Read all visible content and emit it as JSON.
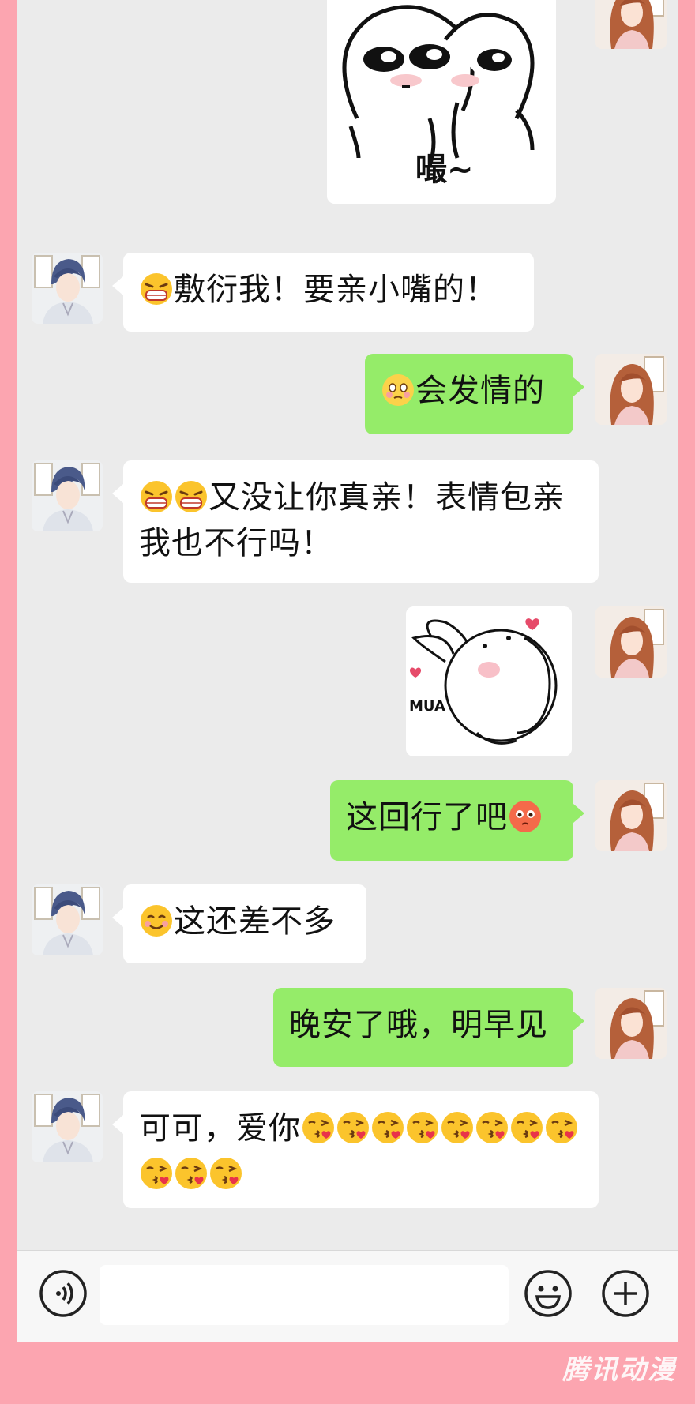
{
  "chat": {
    "messages": [
      {
        "side": "left",
        "emoji": [
          "grimace"
        ],
        "text": "敷衍我！要亲小嘴的！"
      },
      {
        "side": "right",
        "emoji": [
          "flushed"
        ],
        "text": "会发情的"
      },
      {
        "side": "left",
        "emoji": [
          "grimace",
          "grimace"
        ],
        "text": "又没让你真亲！表情包亲我也不行吗！"
      },
      {
        "side": "right",
        "sticker": true,
        "sticker_text": "MUA"
      },
      {
        "side": "right",
        "text": "这回行了吧",
        "emoji_after": [
          "flushed-red"
        ]
      },
      {
        "side": "left",
        "emoji": [
          "smile"
        ],
        "text": "这还差不多"
      },
      {
        "side": "right",
        "text": "晚安了哦，明早见"
      },
      {
        "side": "left",
        "text": "可可，爱你",
        "emoji_after_count": 11
      }
    ],
    "top_sticker_text": "嘬~"
  },
  "inputbar": {
    "voice_icon": "voice-icon",
    "emoji_icon": "emoji-icon",
    "plus_icon": "plus-icon"
  },
  "watermark": "腾讯动漫",
  "colors": {
    "frame": "#fca5b0",
    "screen": "#ebebeb",
    "bubble_self": "#95ec69",
    "bubble_other": "#ffffff"
  }
}
